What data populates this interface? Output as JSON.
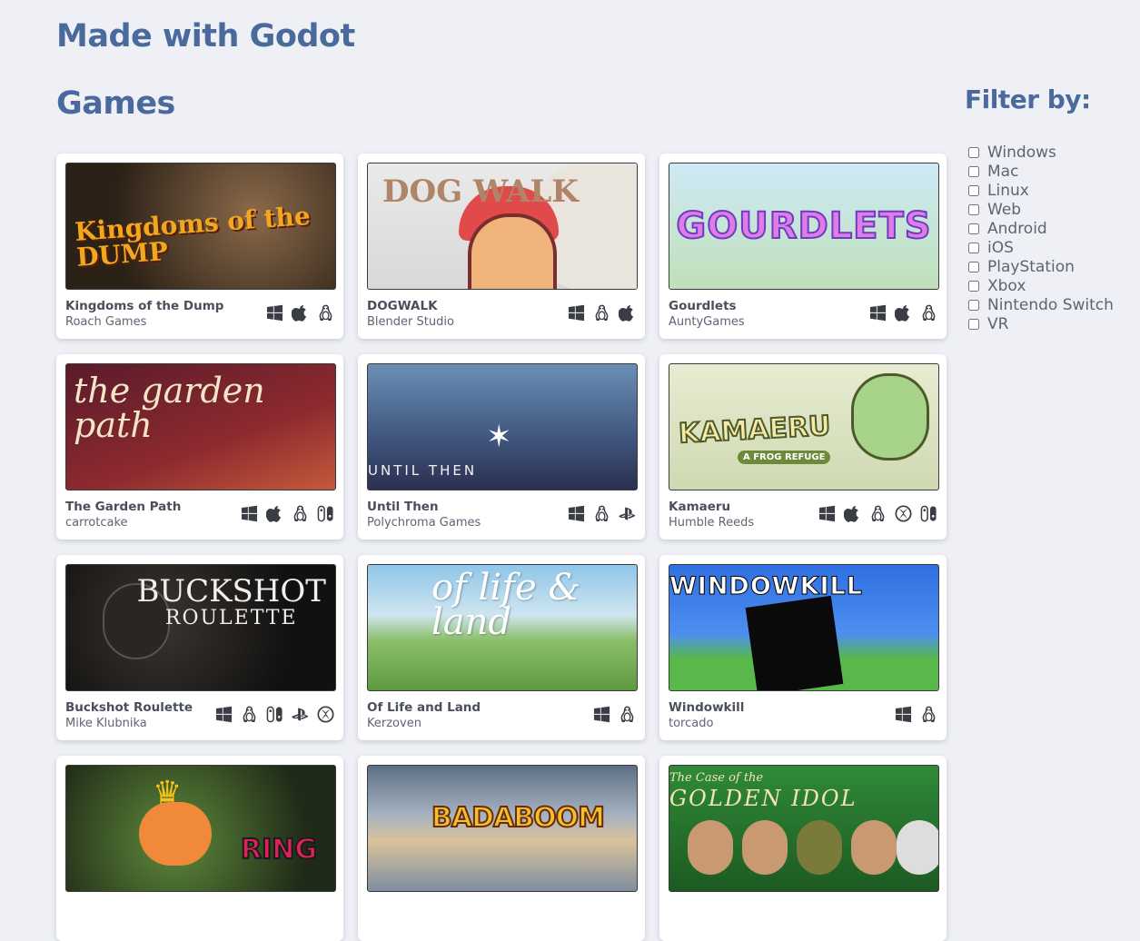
{
  "site": {
    "title": "Made with Godot"
  },
  "section": {
    "title": "Games"
  },
  "filter": {
    "title": "Filter by:",
    "options": [
      "Windows",
      "Mac",
      "Linux",
      "Web",
      "Android",
      "iOS",
      "PlayStation",
      "Xbox",
      "Nintendo Switch",
      "VR"
    ]
  },
  "games": [
    {
      "title": "Kingdoms of the Dump",
      "studio": "Roach Games",
      "art_text": "Kingdoms of the DUMP",
      "platforms": [
        "windows",
        "mac",
        "linux"
      ]
    },
    {
      "title": "DOGWALK",
      "studio": "Blender Studio",
      "art_text": "DOG WALK",
      "platforms": [
        "windows",
        "linux",
        "mac"
      ]
    },
    {
      "title": "Gourdlets",
      "studio": "AuntyGames",
      "art_text": "GOURDLETS",
      "platforms": [
        "windows",
        "mac",
        "linux"
      ]
    },
    {
      "title": "The Garden Path",
      "studio": "carrotcake",
      "art_text": "the garden path",
      "platforms": [
        "windows",
        "mac",
        "linux",
        "switch"
      ]
    },
    {
      "title": "Until Then",
      "studio": "Polychroma Games",
      "art_text": "UNTIL THEN",
      "platforms": [
        "windows",
        "linux",
        "playstation"
      ]
    },
    {
      "title": "Kamaeru",
      "studio": "Humble Reeds",
      "art_text": "KAMAERU",
      "art_sub": "A FROG REFUGE",
      "platforms": [
        "windows",
        "mac",
        "linux",
        "xbox",
        "switch"
      ]
    },
    {
      "title": "Buckshot Roulette",
      "studio": "Mike Klubnika",
      "art_text": "BUCKSHOT",
      "art_sub": "ROULETTE",
      "platforms": [
        "windows",
        "linux",
        "switch",
        "playstation",
        "xbox"
      ]
    },
    {
      "title": "Of Life and Land",
      "studio": "Kerzoven",
      "art_text": "of life & land",
      "platforms": [
        "windows",
        "linux"
      ]
    },
    {
      "title": "Windowkill",
      "studio": "torcado",
      "art_text": "WINDOWKILL",
      "platforms": [
        "windows",
        "linux"
      ]
    },
    {
      "title": "",
      "studio": "",
      "art_text": "RING",
      "platforms": []
    },
    {
      "title": "",
      "studio": "",
      "art_text": "BADABOOM",
      "platforms": []
    },
    {
      "title": "",
      "studio": "",
      "art_text": "The Case of the",
      "art_sub": "GOLDEN IDOL",
      "platforms": []
    }
  ],
  "icons": {
    "windows": "windows-icon",
    "mac": "apple-icon",
    "linux": "linux-icon",
    "switch": "nintendo-switch-icon",
    "playstation": "playstation-icon",
    "xbox": "xbox-icon"
  },
  "colors": {
    "heading": "#4a6a9e",
    "background": "#eef0f5",
    "card": "#ffffff"
  }
}
